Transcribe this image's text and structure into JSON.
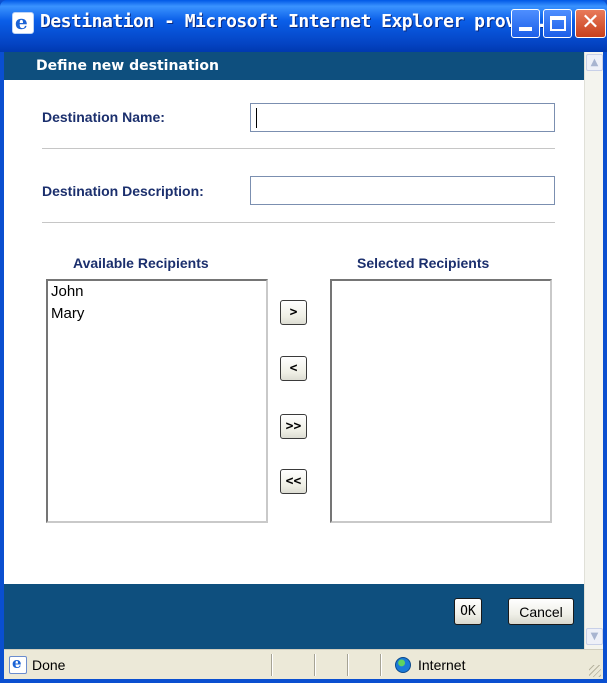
{
  "window": {
    "title": "Destination - Microsoft Internet Explorer provid..."
  },
  "dialog": {
    "header": "Define new destination",
    "name_label": "Destination Name:",
    "name_value": "",
    "description_label": "Destination Description:",
    "description_value": "",
    "available_label": "Available Recipients",
    "selected_label": "Selected Recipients",
    "available_recipients": [
      "John",
      "Mary"
    ],
    "selected_recipients": [],
    "buttons": {
      "add": ">",
      "remove": "<",
      "add_all": ">>",
      "remove_all": "<<",
      "ok": "OK",
      "cancel": "Cancel"
    }
  },
  "statusbar": {
    "status": "Done",
    "zone": "Internet"
  },
  "icons": {
    "title": "ie-logo-icon",
    "status": "ie-page-icon",
    "zone": "internet-globe-icon"
  },
  "colors": {
    "titlebar": "#0a5ee8",
    "dialog_bar": "#0e4f7e",
    "label_text": "#1b2f6d"
  }
}
